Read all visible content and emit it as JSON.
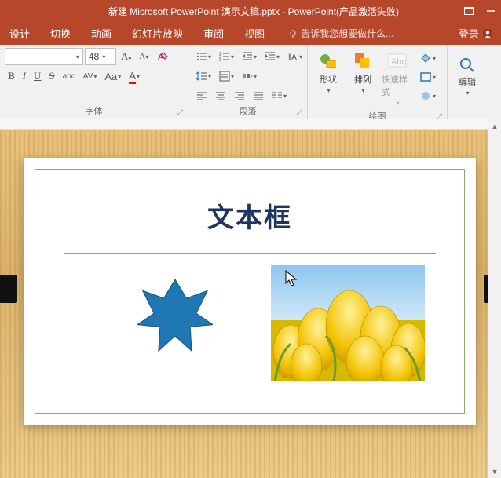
{
  "titlebar": {
    "title": "新建 Microsoft PowerPoint 演示文稿.pptx - PowerPoint(产品激活失败)"
  },
  "tabs": {
    "design": "设计",
    "transitions": "切换",
    "animations": "动画",
    "slideshow": "幻灯片放映",
    "review": "审阅",
    "view": "视图",
    "tell_me_placeholder": "告诉我您想要做什么...",
    "login": "登录"
  },
  "ribbon": {
    "font": {
      "size": "48",
      "bold": "B",
      "italic": "I",
      "underline": "U",
      "strike": "S",
      "shadow": "abc",
      "spacing": "AV",
      "change_case": "Aa",
      "font_color": "A",
      "group_label": "字体"
    },
    "paragraph": {
      "group_label": "段落"
    },
    "drawing": {
      "shapes": "形状",
      "arrange": "排列",
      "quick_styles": "快速样式",
      "group_label": "绘图"
    },
    "editing": {
      "label": "编辑"
    }
  },
  "slide": {
    "title": "文本框"
  }
}
